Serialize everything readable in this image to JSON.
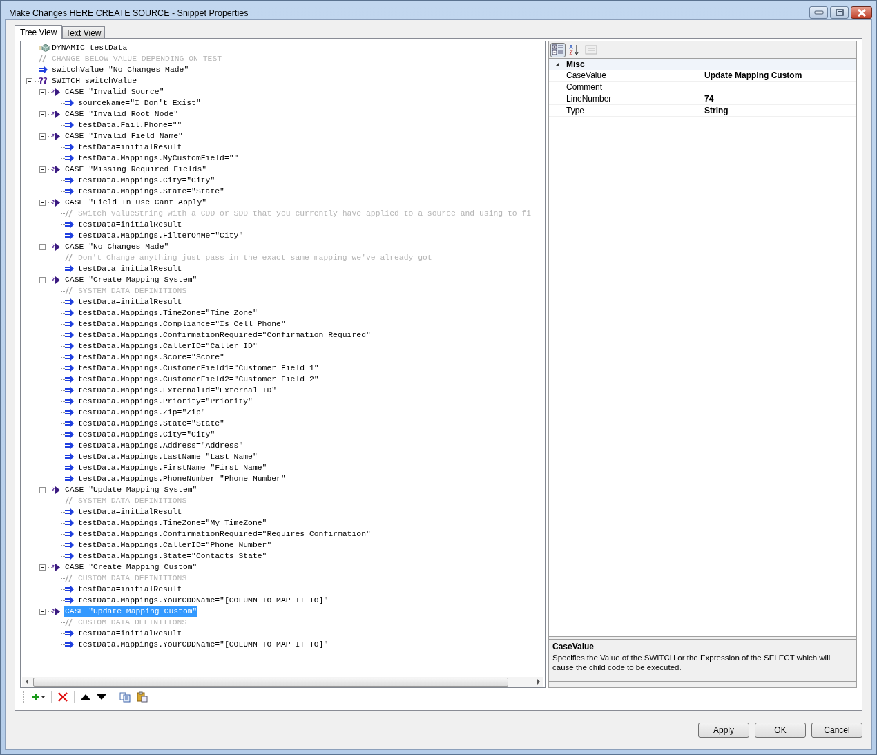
{
  "window": {
    "title": "Make Changes HERE CREATE SOURCE - Snippet Properties"
  },
  "tabs": [
    {
      "label": "Tree View",
      "selected": true
    },
    {
      "label": "Text View",
      "selected": false
    }
  ],
  "tree": [
    {
      "kind": "dynamic",
      "text": "DYNAMIC testData",
      "selected": false
    },
    {
      "kind": "comment",
      "text": " CHANGE BELOW VALUE DEPENDING ON TEST",
      "selected": false
    },
    {
      "kind": "assign",
      "text": "switchValue=\"No Changes Made\"",
      "selected": false
    },
    {
      "kind": "switch",
      "symbol": "??",
      "text": "SWITCH switchValue",
      "expanded": true,
      "selected": false,
      "children": [
        {
          "kind": "case",
          "symbol": "?",
          "text": "CASE \"Invalid Source\"",
          "expanded": true,
          "selected": false,
          "children": [
            {
              "kind": "assign",
              "text": "sourceName=\"I Don't Exist\"",
              "selected": false
            }
          ]
        },
        {
          "kind": "case",
          "symbol": "?",
          "text": "CASE \"Invalid Root Node\"",
          "expanded": true,
          "selected": false,
          "children": [
            {
              "kind": "assign",
              "text": "testData.Fail.Phone=\"\"",
              "selected": false
            }
          ]
        },
        {
          "kind": "case",
          "symbol": "?",
          "text": "CASE \"Invalid Field Name\"",
          "expanded": true,
          "selected": false,
          "children": [
            {
              "kind": "assign",
              "text": "testData=initialResult",
              "selected": false
            },
            {
              "kind": "assign",
              "text": "testData.Mappings.MyCustomField=\"\"",
              "selected": false
            }
          ]
        },
        {
          "kind": "case",
          "symbol": "?",
          "text": "CASE \"Missing Required Fields\"",
          "expanded": true,
          "selected": false,
          "children": [
            {
              "kind": "assign",
              "text": "testData.Mappings.City=\"City\"",
              "selected": false
            },
            {
              "kind": "assign",
              "text": "testData.Mappings.State=\"State\"",
              "selected": false
            }
          ]
        },
        {
          "kind": "case",
          "symbol": "?",
          "text": "CASE \"Field In Use Cant Apply\"",
          "expanded": true,
          "selected": false,
          "children": [
            {
              "kind": "comment",
              "text": " Switch ValueString with a CDD or SDD that you currently have applied to a source and using to fi",
              "selected": false
            },
            {
              "kind": "assign",
              "text": "testData=initialResult",
              "selected": false
            },
            {
              "kind": "assign",
              "text": "testData.Mappings.FilterOnMe=\"City\"",
              "selected": false
            }
          ]
        },
        {
          "kind": "case",
          "symbol": "?",
          "text": "CASE \"No Changes Made\"",
          "expanded": true,
          "selected": false,
          "children": [
            {
              "kind": "comment",
              "text": " Don't Change anything just pass in the exact same mapping we've already got",
              "selected": false
            },
            {
              "kind": "assign",
              "text": "testData=initialResult",
              "selected": false
            }
          ]
        },
        {
          "kind": "case",
          "symbol": "?",
          "text": "CASE \"Create Mapping System\"",
          "expanded": true,
          "selected": false,
          "children": [
            {
              "kind": "comment",
              "text": " SYSTEM DATA DEFINITIONS",
              "selected": false
            },
            {
              "kind": "assign",
              "text": "testData=initialResult",
              "selected": false
            },
            {
              "kind": "assign",
              "text": "testData.Mappings.TimeZone=\"Time Zone\"",
              "selected": false
            },
            {
              "kind": "assign",
              "text": "testData.Mappings.Compliance=\"Is Cell Phone\"",
              "selected": false
            },
            {
              "kind": "assign",
              "text": "testData.Mappings.ConfirmationRequired=\"Confirmation Required\"",
              "selected": false
            },
            {
              "kind": "assign",
              "text": "testData.Mappings.CallerID=\"Caller ID\"",
              "selected": false
            },
            {
              "kind": "assign",
              "text": "testData.Mappings.Score=\"Score\"",
              "selected": false
            },
            {
              "kind": "assign",
              "text": "testData.Mappings.CustomerField1=\"Customer Field 1\"",
              "selected": false
            },
            {
              "kind": "assign",
              "text": "testData.Mappings.CustomerField2=\"Customer Field 2\"",
              "selected": false
            },
            {
              "kind": "assign",
              "text": "testData.Mappings.ExternalId=\"External ID\"",
              "selected": false
            },
            {
              "kind": "assign",
              "text": "testData.Mappings.Priority=\"Priority\"",
              "selected": false
            },
            {
              "kind": "assign",
              "text": "testData.Mappings.Zip=\"Zip\"",
              "selected": false
            },
            {
              "kind": "assign",
              "text": "testData.Mappings.State=\"State\"",
              "selected": false
            },
            {
              "kind": "assign",
              "text": "testData.Mappings.City=\"City\"",
              "selected": false
            },
            {
              "kind": "assign",
              "text": "testData.Mappings.Address=\"Address\"",
              "selected": false
            },
            {
              "kind": "assign",
              "text": "testData.Mappings.LastName=\"Last Name\"",
              "selected": false
            },
            {
              "kind": "assign",
              "text": "testData.Mappings.FirstName=\"First Name\"",
              "selected": false
            },
            {
              "kind": "assign",
              "text": "testData.Mappings.PhoneNumber=\"Phone Number\"",
              "selected": false
            }
          ]
        },
        {
          "kind": "case",
          "symbol": "?",
          "text": "CASE \"Update Mapping System\"",
          "expanded": true,
          "selected": false,
          "children": [
            {
              "kind": "comment",
              "text": " SYSTEM DATA DEFINITIONS",
              "selected": false
            },
            {
              "kind": "assign",
              "text": "testData=initialResult",
              "selected": false
            },
            {
              "kind": "assign",
              "text": "testData.Mappings.TimeZone=\"My TimeZone\"",
              "selected": false
            },
            {
              "kind": "assign",
              "text": "testData.Mappings.ConfirmationRequired=\"Requires Confirmation\"",
              "selected": false
            },
            {
              "kind": "assign",
              "text": "testData.Mappings.CallerID=\"Phone Number\"",
              "selected": false
            },
            {
              "kind": "assign",
              "text": "testData.Mappings.State=\"Contacts State\"",
              "selected": false
            }
          ]
        },
        {
          "kind": "case",
          "symbol": "?",
          "text": "CASE \"Create Mapping Custom\"",
          "expanded": true,
          "selected": false,
          "children": [
            {
              "kind": "comment",
              "text": " CUSTOM DATA DEFINITIONS",
              "selected": false
            },
            {
              "kind": "assign",
              "text": "testData=initialResult",
              "selected": false
            },
            {
              "kind": "assign",
              "text": "testData.Mappings.YourCDDName=\"[COLUMN TO MAP IT TO]\"",
              "selected": false
            }
          ]
        },
        {
          "kind": "case",
          "symbol": "?",
          "text": "CASE \"Update Mapping Custom\"",
          "expanded": true,
          "selected": true,
          "children": [
            {
              "kind": "comment",
              "text": " CUSTOM DATA DEFINITIONS",
              "selected": false
            },
            {
              "kind": "assign",
              "text": "testData=initialResult",
              "selected": false
            },
            {
              "kind": "assign",
              "text": "testData.Mappings.YourCDDName=\"[COLUMN TO MAP IT TO]\"",
              "selected": false
            }
          ]
        }
      ]
    }
  ],
  "tree_toolbar": [
    {
      "kind": "add"
    },
    {
      "kind": "delete"
    },
    {
      "kind": "up"
    },
    {
      "kind": "down"
    },
    {
      "kind": "copy"
    },
    {
      "kind": "paste"
    }
  ],
  "grid_toolbar": [
    {
      "kind": "categorized",
      "selected": true,
      "disabled": false
    },
    {
      "kind": "alphabetical",
      "selected": false,
      "disabled": false
    },
    {
      "kind": "pages",
      "selected": false,
      "disabled": true
    }
  ],
  "properties": {
    "category": "Misc",
    "expanded": true,
    "rows": [
      {
        "name": "CaseValue",
        "value": "Update Mapping Custom"
      },
      {
        "name": "Comment"
      },
      {
        "name": "LineNumber",
        "value": "74"
      },
      {
        "name": "Type",
        "value": "String"
      }
    ]
  },
  "description": {
    "title": "CaseValue",
    "text": "Specifies the Value of the SWITCH or the Expression of the SELECT which will cause the child code to be executed."
  },
  "buttons": [
    "Apply",
    "OK",
    "Cancel"
  ]
}
